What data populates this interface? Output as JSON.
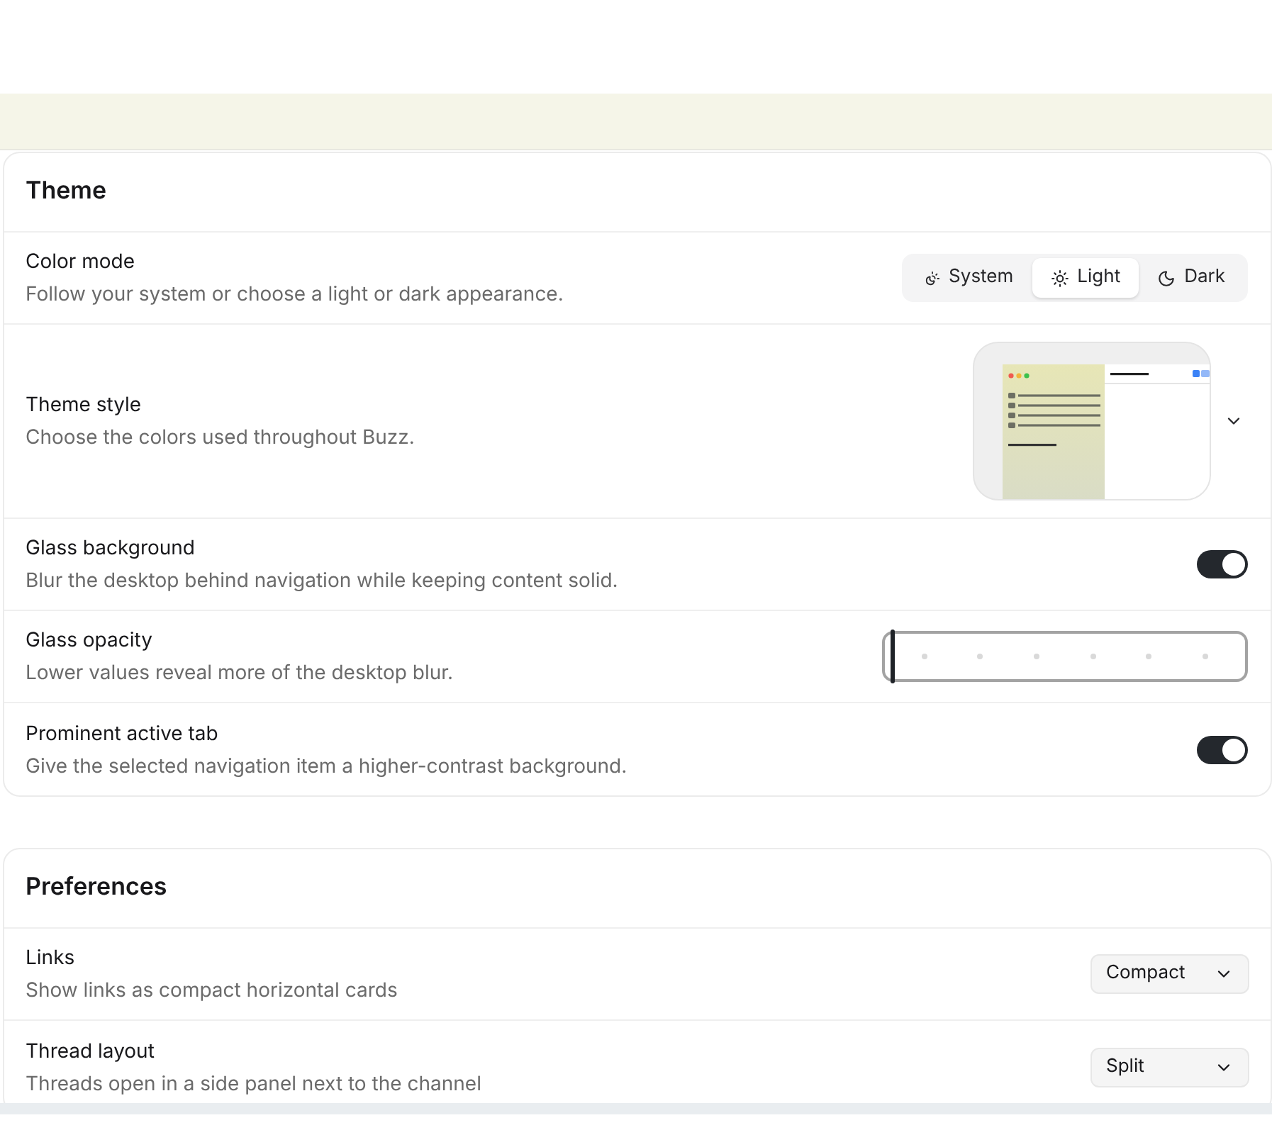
{
  "sections": [
    {
      "title": "Theme",
      "rows": [
        {
          "kind": "segmented",
          "label": "Color mode",
          "description": "Follow your system or choose a light or dark appearance.",
          "options": [
            {
              "kind": "system",
              "label": "System",
              "selected": false
            },
            {
              "kind": "light",
              "label": "Light",
              "selected": true
            },
            {
              "kind": "dark",
              "label": "Dark",
              "selected": false
            }
          ]
        },
        {
          "kind": "preview",
          "label": "Theme style",
          "description": "Choose the colors used throughout Buzz."
        },
        {
          "kind": "toggle",
          "label": "Glass background",
          "description": "Blur the desktop behind navigation while keeping content solid.",
          "on": true
        },
        {
          "kind": "slider",
          "label": "Glass opacity",
          "description": "Lower values reveal more of the desktop blur.",
          "level": 0
        },
        {
          "kind": "toggle",
          "label": "Prominent active tab",
          "description": "Give the selected navigation item a higher-contrast background.",
          "on": true
        }
      ]
    },
    {
      "title": "Preferences",
      "rows": [
        {
          "kind": "select",
          "label": "Links",
          "description": "Show links as compact horizontal cards",
          "value": "Compact"
        },
        {
          "kind": "select",
          "label": "Thread layout",
          "description": "Threads open in a side panel next to the channel",
          "value": "Split"
        }
      ]
    }
  ]
}
